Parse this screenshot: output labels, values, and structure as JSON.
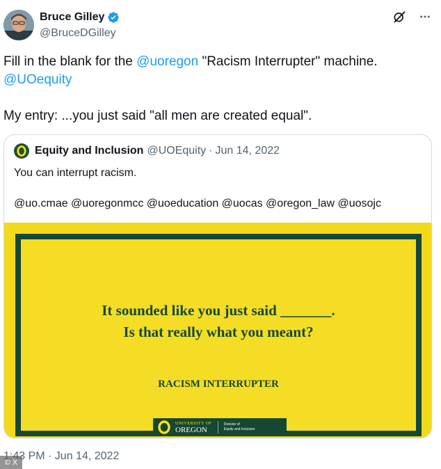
{
  "author": {
    "name": "Bruce Gilley",
    "handle": "@BruceDGilley",
    "verified": true,
    "avatar_icon": "profile-photo"
  },
  "tweet": {
    "text_part1": "Fill in the blank for the ",
    "mention1": "@uoregon",
    "text_part2": " \"Racism Interrupter\" machine.",
    "mention2": "@UOequity",
    "entry": "My entry: ...you just said \"all men are created equal\".",
    "timestamp": "1:43 PM · Jun 14, 2022"
  },
  "quoted": {
    "name": "Equity and Inclusion",
    "handle": "@UOEquity",
    "separator": "·",
    "date": "Jun 14, 2022",
    "text": "You can interrupt racism.",
    "mentions": "@uo.cmae @uoregonmcc @uoeducation @uocas @oregon_law @uosojc",
    "image": {
      "line1": "It sounded like you just said _______.",
      "line2": "Is that really what you meant?",
      "footer": "RACISM INTERRUPTER",
      "logo_small": "UNIVERSITY OF",
      "logo_big": "OREGON",
      "division_line1": "Division of",
      "division_line2": "Equity and Inclusion"
    }
  },
  "icons": {
    "grok": "grok-icon",
    "more": "more-icon"
  },
  "watermark": "© X",
  "colors": {
    "link": "#1d9bf0",
    "secondary_text": "#536471",
    "uo_green": "#154734",
    "uo_yellow": "#f4dd24"
  }
}
